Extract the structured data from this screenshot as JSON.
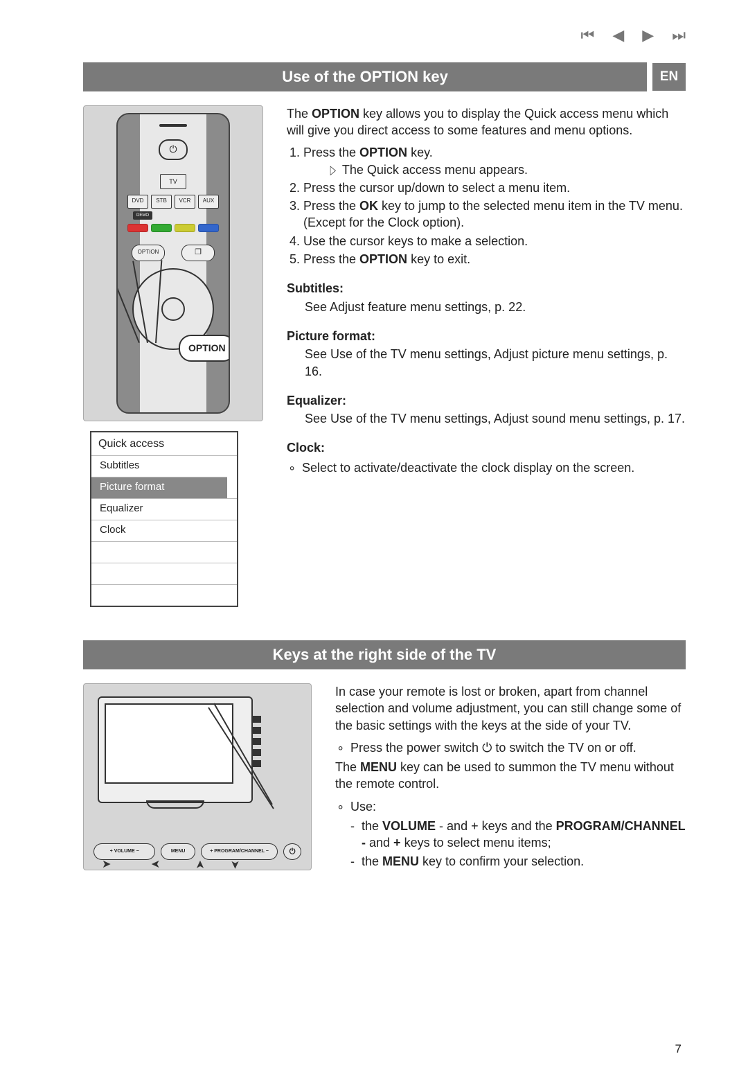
{
  "page_number": "7",
  "nav_icons": {
    "first": "⏮",
    "prev": "◀",
    "play": "▶",
    "next": "⏭"
  },
  "lang_badge": "EN",
  "section1": {
    "title": "Use of the OPTION key",
    "intro_before": "The ",
    "intro_key": "OPTION",
    "intro_after": " key allows you to display the Quick access menu which will give you direct access to some features and menu options.",
    "step1a": "Press the ",
    "step1b": "OPTION",
    "step1c": " key.",
    "step1_sub": "The Quick access menu appears.",
    "step2": "Press the cursor up/down to select a menu item.",
    "step3a": "Press the ",
    "step3b": "OK",
    "step3c": " key to jump to the selected menu item in the TV menu. (Except for the Clock option).",
    "step4": "Use the cursor keys to make a selection.",
    "step5a": "Press the ",
    "step5b": "OPTION",
    "step5c": " key to exit.",
    "h_sub": "Subtitles:",
    "t_sub": "See Adjust feature menu settings, p. 22.",
    "h_pic": "Picture format:",
    "t_pic": "See Use of the TV menu settings, Adjust picture menu settings, p. 16.",
    "h_eq": "Equalizer:",
    "t_eq": "See Use of the TV menu settings, Adjust sound menu settings, p. 17.",
    "h_clk": "Clock:",
    "t_clk": "Select to activate/deactivate the clock display on the screen."
  },
  "remote": {
    "power_glyph": "⏻",
    "tv": "TV",
    "devices": [
      "DVD",
      "STB",
      "VCR",
      "AUX"
    ],
    "demo": "DEMO",
    "colors": [
      "#d33",
      "#3a3",
      "#cc3",
      "#36c"
    ],
    "option": "OPTION",
    "teletext_glyph": "❐",
    "bubble": "OPTION"
  },
  "quick_menu": {
    "title": "Quick access",
    "items": [
      "Subtitles",
      "Picture format",
      "Equalizer",
      "Clock",
      "",
      "",
      ""
    ],
    "selected_index": 1
  },
  "section2": {
    "title": "Keys at the right side of the TV",
    "p1": "In case your remote is lost or broken, apart from channel selection and volume adjustment, you can still change some of the basic settings with the keys at the side of your TV.",
    "b1a": "Press the power switch ",
    "b1_glyph": "⏻",
    "b1b": " to switch the TV on or off.",
    "p2a": "The ",
    "p2b": "MENU",
    "p2c": " key can be used to summon the TV menu without the remote control.",
    "b2": "Use:",
    "d1a": "the ",
    "d1b": "VOLUME",
    "d1c": " - and + keys and the ",
    "d1d": "PROGRAM/CHANNEL -",
    "d1e": " and ",
    "d1f": "+",
    "d1g": "  keys to select menu items;",
    "d2a": "the ",
    "d2b": "MENU",
    "d2c": " key to confirm your selection."
  },
  "tv_controls": {
    "volume": "+     VOLUME     −",
    "menu": "MENU",
    "program": "+   PROGRAM/CHANNEL   −",
    "power": "⏻"
  }
}
